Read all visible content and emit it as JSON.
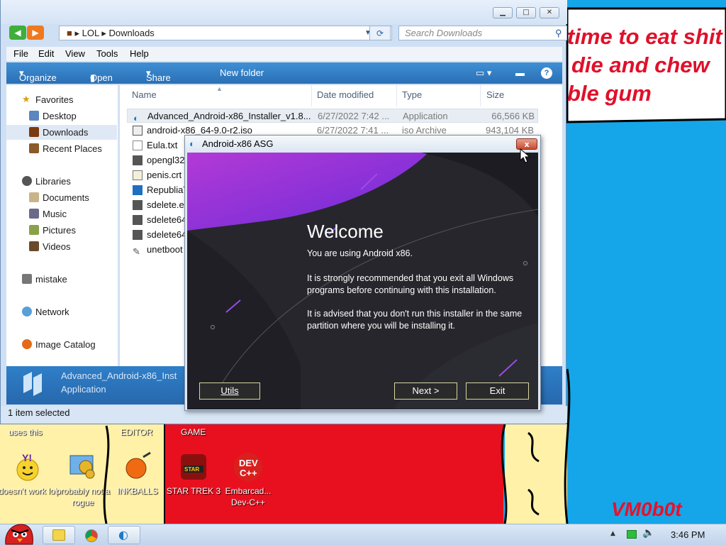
{
  "desktop": {
    "meme_lines": [
      "time to eat shit",
      "die and chew",
      "ble gum"
    ],
    "signature": "VM0b0t",
    "labels_top": [
      "uses this",
      "EDITOR",
      "GAME"
    ],
    "icons": [
      {
        "name": "yahoo-messenger-icon",
        "label": "doesn't work lol"
      },
      {
        "name": "control-panel-icon",
        "label": "probably not a rogue"
      },
      {
        "name": "inkball-icon",
        "label": "INKBALLS"
      },
      {
        "name": "star-trek-icon",
        "label": "STAR TREK 3"
      },
      {
        "name": "dev-cpp-icon",
        "label": "Embarcad... Dev-C++"
      }
    ]
  },
  "explorer": {
    "breadcrumb": [
      "LOL",
      "Downloads"
    ],
    "search_placeholder": "Search Downloads",
    "menu": [
      "File",
      "Edit",
      "View",
      "Tools",
      "Help"
    ],
    "commands": [
      "Organize",
      "Open",
      "Share with",
      "New folder"
    ],
    "nav": {
      "favorites": {
        "label": "Favorites",
        "items": [
          "Desktop",
          "Downloads",
          "Recent Places"
        ]
      },
      "libraries": {
        "label": "Libraries",
        "items": [
          "Documents",
          "Music",
          "Pictures",
          "Videos"
        ]
      },
      "other": [
        "mistake",
        "Network",
        "Image Catalog"
      ]
    },
    "columns": [
      "Name",
      "Date modified",
      "Type",
      "Size"
    ],
    "files": [
      {
        "name": "Advanced_Android-x86_Installer_v1.8...",
        "date": "6/27/2022 7:42 ...",
        "type": "Application",
        "size": "66,566 KB"
      },
      {
        "name": "android-x86_64-9.0-r2.iso",
        "date": "6/27/2022 7:41 ...",
        "type": "iso Archive",
        "size": "943,104 KB"
      },
      {
        "name": "Eula.txt",
        "date": "",
        "type": "",
        "size": ""
      },
      {
        "name": "opengl32",
        "date": "",
        "type": "",
        "size": ""
      },
      {
        "name": "penis.crt",
        "date": "",
        "type": "",
        "size": ""
      },
      {
        "name": "RepubliaT",
        "date": "",
        "type": "",
        "size": ""
      },
      {
        "name": "sdelete.e",
        "date": "",
        "type": "",
        "size": ""
      },
      {
        "name": "sdelete64",
        "date": "",
        "type": "",
        "size": ""
      },
      {
        "name": "sdelete64",
        "date": "",
        "type": "",
        "size": ""
      },
      {
        "name": "unetboot",
        "date": "",
        "type": "",
        "size": ""
      }
    ],
    "details": {
      "name": "Advanced_Android-x86_Inst",
      "type": "Application"
    },
    "status": "1 item selected"
  },
  "dialog": {
    "title": "Android-x86 ASG",
    "close": "x",
    "heading": "Welcome",
    "line1": "You are using Android  x86.",
    "para2": "It is strongly recommended that you exit all Windows programs before continuing with this installation.",
    "para3": "It is advised that you don't run this installer in the same partition where you will be installing it.",
    "buttons": {
      "utils": "Utils",
      "next": "Next >",
      "exit": "Exit"
    }
  },
  "taskbar": {
    "clock": "3:46 PM"
  }
}
